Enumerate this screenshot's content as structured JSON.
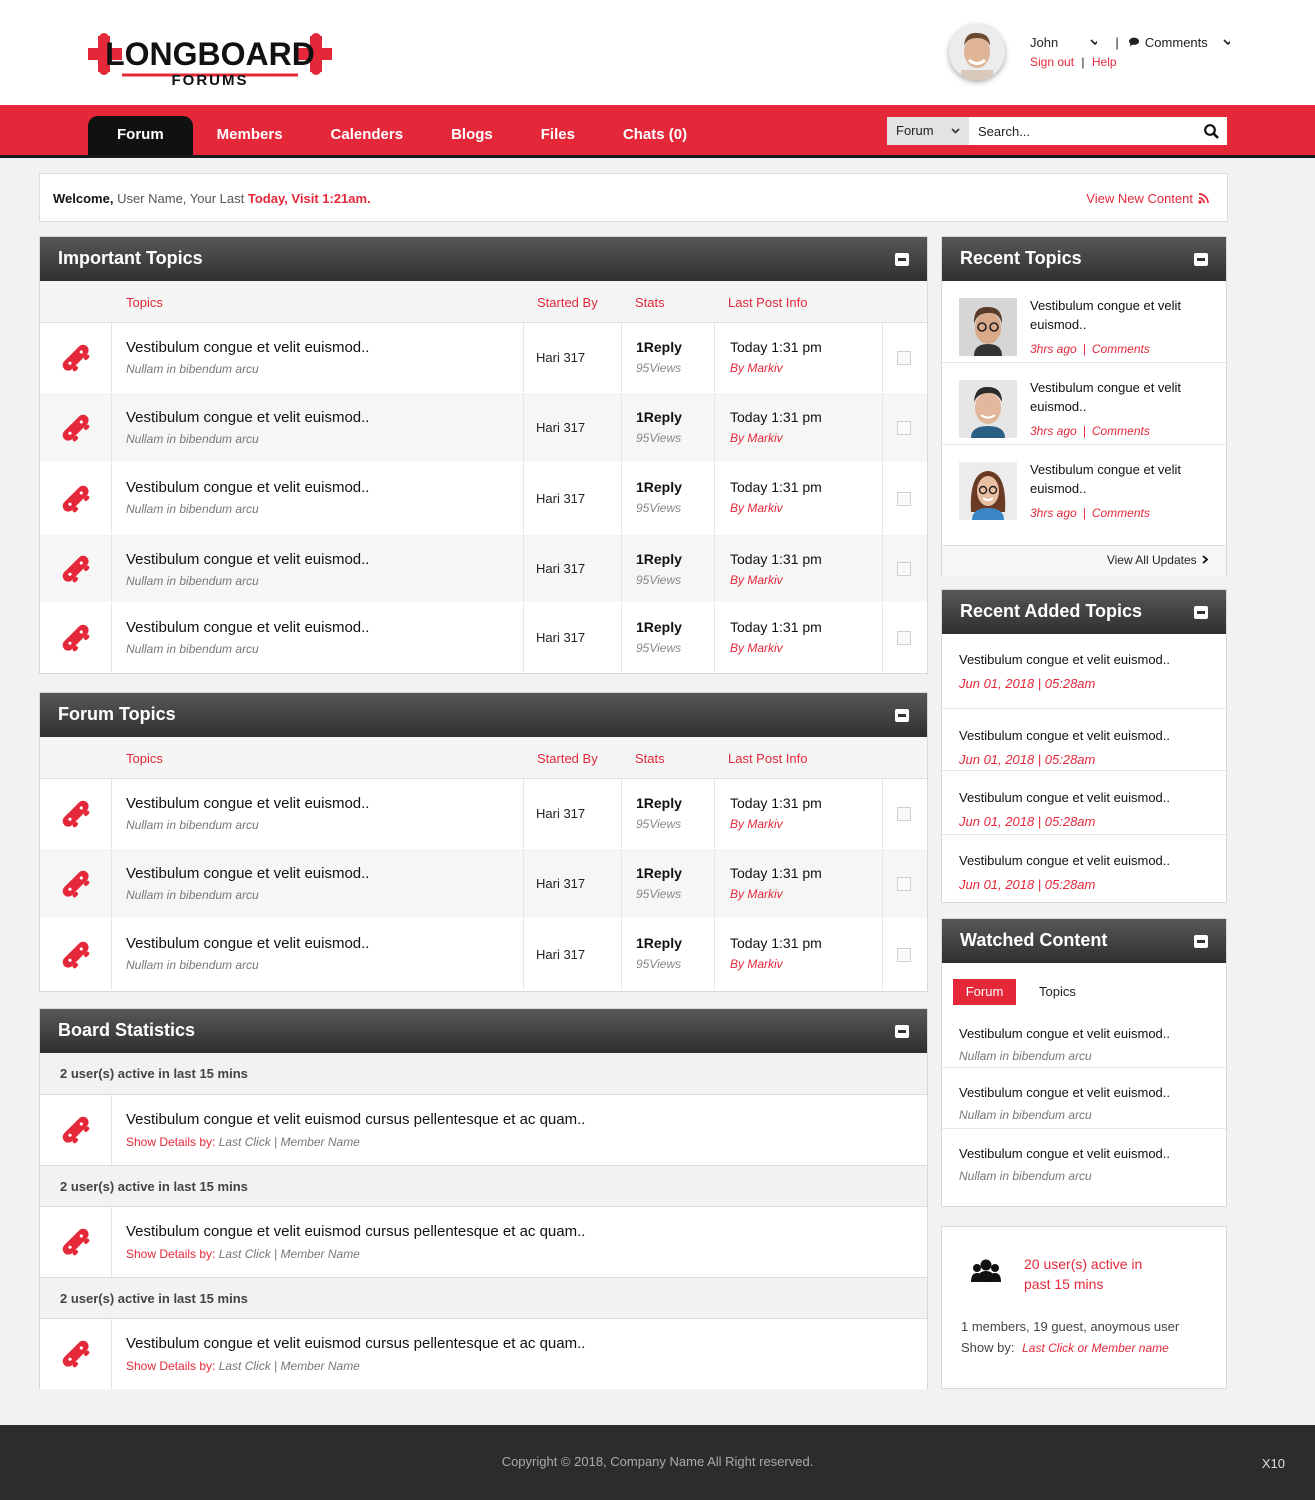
{
  "app": {
    "logo_top": "LONGBOARD",
    "logo_bottom": "FORUMS"
  },
  "user": {
    "name": "John",
    "sign_out": "Sign out",
    "help": "Help",
    "comments": "Comments"
  },
  "nav": {
    "tabs": [
      "Forum",
      "Members",
      "Calenders",
      "Blogs",
      "Files",
      "Chats (0)"
    ],
    "active": "Forum"
  },
  "search": {
    "scope": "Forum",
    "placeholder": "Search..."
  },
  "welcome": {
    "bold": "Welcome,",
    "text": " User Name, Your Last ",
    "highlight": "Today,  Visit 1:21am.",
    "view_new": "View New Content"
  },
  "important": {
    "title": "Important Topics",
    "headers": {
      "topics": "Topics",
      "started_by": "Started By",
      "stats": "Stats",
      "last_post": "Last Post Info"
    },
    "rows": [
      {
        "title": "Vestibulum congue et velit euismod..",
        "sub": "Nullam in bibendum arcu",
        "by": "Hari 317",
        "replies": "1Reply",
        "views": "95Views",
        "time": "Today 1:31 pm",
        "author": "By Markiv"
      },
      {
        "title": "Vestibulum congue et velit euismod..",
        "sub": "Nullam in bibendum arcu",
        "by": "Hari 317",
        "replies": "1Reply",
        "views": "95Views",
        "time": "Today 1:31 pm",
        "author": "By Markiv"
      },
      {
        "title": "Vestibulum congue et velit euismod..",
        "sub": "Nullam in bibendum arcu",
        "by": "Hari 317",
        "replies": "1Reply",
        "views": "95Views",
        "time": "Today 1:31 pm",
        "author": "By Markiv"
      },
      {
        "title": "Vestibulum congue et velit euismod..",
        "sub": "Nullam in bibendum arcu",
        "by": "Hari 317",
        "replies": "1Reply",
        "views": "95Views",
        "time": "Today 1:31 pm",
        "author": "By Markiv"
      },
      {
        "title": "Vestibulum congue et velit euismod..",
        "sub": "Nullam in bibendum arcu",
        "by": "Hari 317",
        "replies": "1Reply",
        "views": "95Views",
        "time": "Today 1:31 pm",
        "author": "By Markiv"
      }
    ]
  },
  "forum": {
    "title": "Forum Topics",
    "headers": {
      "topics": "Topics",
      "started_by": "Started By",
      "stats": "Stats",
      "last_post": "Last Post Info"
    },
    "rows": [
      {
        "title": "Vestibulum congue et velit euismod..",
        "sub": "Nullam in bibendum arcu",
        "by": "Hari 317",
        "replies": "1Reply",
        "views": "95Views",
        "time": "Today 1:31 pm",
        "author": "By Markiv"
      },
      {
        "title": "Vestibulum congue et velit euismod..",
        "sub": "Nullam in bibendum arcu",
        "by": "Hari 317",
        "replies": "1Reply",
        "views": "95Views",
        "time": "Today 1:31 pm",
        "author": "By Markiv"
      },
      {
        "title": "Vestibulum congue et velit euismod..",
        "sub": "Nullam in bibendum arcu",
        "by": "Hari 317",
        "replies": "1Reply",
        "views": "95Views",
        "time": "Today 1:31 pm",
        "author": "By Markiv"
      }
    ]
  },
  "board": {
    "title": "Board Statistics",
    "groups": [
      {
        "head": "2 user(s) active in last 15 mins",
        "title": "Vestibulum congue et velit euismod cursus pellentesque et ac quam..",
        "label": "Show Details by:",
        "detail": " Last Click  |  Member Name"
      },
      {
        "head": "2 user(s) active in last 15 mins",
        "title": "Vestibulum congue et velit euismod cursus pellentesque et ac quam..",
        "label": "Show Details by:",
        "detail": " Last Click  |  Member Name"
      },
      {
        "head": "2 user(s) active in last 15 mins",
        "title": "Vestibulum congue et velit euismod cursus pellentesque et ac quam..",
        "label": "Show Details by:",
        "detail": " Last Click  |  Member Name"
      }
    ]
  },
  "recent": {
    "title": "Recent Topics",
    "items": [
      {
        "text": "Vestibulum congue et velit euismod..",
        "ago": "3hrs ago",
        "comments": "Comments"
      },
      {
        "text": "Vestibulum congue et velit euismod..",
        "ago": "3hrs ago",
        "comments": "Comments"
      },
      {
        "text": "Vestibulum congue et velit euismod..",
        "ago": "3hrs ago",
        "comments": "Comments"
      }
    ],
    "view_all": "View All Updates"
  },
  "recent_added": {
    "title": "Recent Added Topics",
    "items": [
      {
        "text": "Vestibulum congue et velit euismod..",
        "date": "Jun 01, 2018  |  05:28am"
      },
      {
        "text": "Vestibulum congue et velit euismod..",
        "date": "Jun 01, 2018  |  05:28am"
      },
      {
        "text": "Vestibulum congue et velit euismod..",
        "date": "Jun 01, 2018  |  05:28am"
      },
      {
        "text": "Vestibulum congue et velit euismod..",
        "date": "Jun 01, 2018  |  05:28am"
      }
    ]
  },
  "watched": {
    "title": "Watched Content",
    "tabs": [
      "Forum",
      "Topics"
    ],
    "items": [
      {
        "text": "Vestibulum congue et velit euismod..",
        "sub": "Nullam in bibendum arcu"
      },
      {
        "text": "Vestibulum congue et velit euismod..",
        "sub": "Nullam in bibendum arcu"
      },
      {
        "text": "Vestibulum congue et velit euismod..",
        "sub": "Nullam in bibendum arcu"
      }
    ]
  },
  "online": {
    "line1": "20 user(s) active in",
    "line2": "past 15 mins",
    "summary": "1 members, 19 guest, anoymous user",
    "show_by": "Show by:",
    "show_link": "Last Click or Member name"
  },
  "footer": {
    "copyright": "Copyright © 2018, Company Name All Right reserved.",
    "badge": "X10"
  },
  "colors": {
    "accent": "#e4283a",
    "panel_header": "#3a3a3a",
    "nav_active": "#111111",
    "footer": "#2c2c2c"
  }
}
